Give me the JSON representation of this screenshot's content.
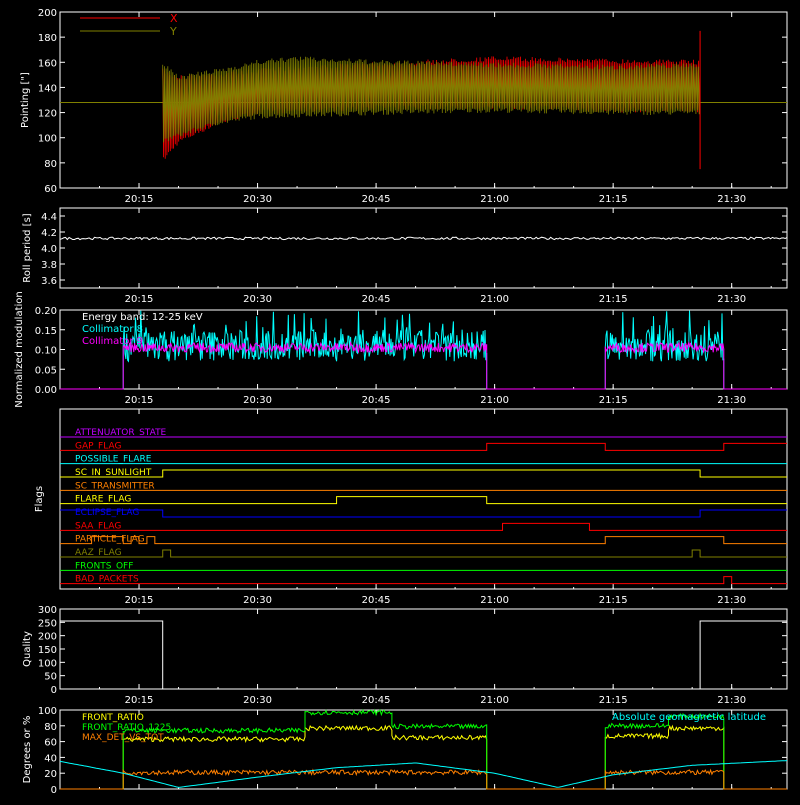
{
  "colors": {
    "background": "#000000",
    "axes": "#ffffff",
    "x_series": "#ff0000",
    "y_series": "#808000",
    "cyan": "#00ffff",
    "magenta": "#ff00ff",
    "green": "#00ff00",
    "yellow": "#ffff00",
    "orange": "#ff8000",
    "blue": "#0000ff",
    "purple": "#c000ff"
  },
  "time_ticks": [
    "20:15",
    "20:30",
    "20:45",
    "21:00",
    "21:15",
    "21:30"
  ],
  "chart_data": [
    {
      "id": "pointing",
      "type": "line",
      "ylabel": "Pointing [\"]",
      "ylim": [
        60,
        200
      ],
      "yticks": [
        "60",
        "80",
        "100",
        "120",
        "140",
        "160",
        "180",
        "200"
      ],
      "time_range": [
        "20:05",
        "21:37"
      ],
      "legend_placement": "top-left",
      "series": [
        {
          "name": "X",
          "color": "#ff0000",
          "t_start": "20:18",
          "t_end": "21:26",
          "x": [
            "20:18",
            "20:20",
            "20:25",
            "20:30",
            "20:35",
            "20:45",
            "21:00",
            "21:15",
            "21:26"
          ],
          "upper": [
            155,
            150,
            152,
            155,
            158,
            160,
            165,
            163,
            162
          ],
          "lower": [
            80,
            95,
            110,
            118,
            120,
            122,
            123,
            120,
            120
          ]
        },
        {
          "name": "Y",
          "color": "#808000",
          "t_start": "20:18",
          "t_end": "21:26",
          "x": [
            "20:18",
            "20:20",
            "20:25",
            "20:30",
            "20:35",
            "20:45",
            "21:00",
            "21:15",
            "21:26"
          ],
          "upper": [
            160,
            150,
            155,
            162,
            165,
            162,
            160,
            158,
            160
          ],
          "lower": [
            95,
            100,
            110,
            115,
            116,
            118,
            120,
            118,
            118
          ]
        }
      ],
      "baseline": 128
    },
    {
      "id": "roll_period",
      "type": "line",
      "ylabel": "Roll period [s]",
      "ylim": [
        3.5,
        4.5
      ],
      "yticks": [
        "3.6",
        "3.8",
        "4.0",
        "4.2",
        "4.4"
      ],
      "series": [
        {
          "name": "",
          "color": "#ffffff",
          "x": [
            "20:05",
            "21:37"
          ],
          "y": [
            4.12,
            4.12
          ]
        }
      ]
    },
    {
      "id": "modulation",
      "type": "line",
      "ylabel": "Normalized modulation",
      "ylim": [
        0,
        0.2
      ],
      "yticks": [
        "0.00",
        "0.05",
        "0.10",
        "0.15",
        "0.20"
      ],
      "annotation": "Energy band: 12-25 keV",
      "series": [
        {
          "name": "Collimator 8",
          "color": "#00ffff",
          "intervals": [
            [
              "20:13",
              "20:59"
            ],
            [
              "21:14",
              "21:29"
            ]
          ],
          "mean": 0.11,
          "spread": 0.04
        },
        {
          "name": "Collimator 9",
          "color": "#ff00ff",
          "intervals": [
            [
              "20:13",
              "20:59"
            ],
            [
              "21:14",
              "21:29"
            ]
          ],
          "mean": 0.105,
          "spread": 0.012
        }
      ]
    },
    {
      "id": "flags",
      "type": "line",
      "ylabel": "Flags",
      "series": [
        {
          "name": "ATTENUATOR_STATE",
          "color": "#c000ff",
          "steps": [
            [
              "20:05",
              0
            ]
          ]
        },
        {
          "name": "GAP_FLAG",
          "color": "#ff0000",
          "steps": [
            [
              "20:05",
              0
            ],
            [
              "20:59",
              1
            ],
            [
              "21:14",
              0
            ],
            [
              "21:29",
              1
            ]
          ]
        },
        {
          "name": "POSSIBLE_FLARE",
          "color": "#00ffff",
          "steps": [
            [
              "20:05",
              0
            ]
          ]
        },
        {
          "name": "SC_IN_SUNLIGHT",
          "color": "#ffff00",
          "steps": [
            [
              "20:05",
              0
            ],
            [
              "20:18",
              1
            ],
            [
              "21:26",
              0
            ]
          ]
        },
        {
          "name": "SC_TRANSMITTER",
          "color": "#ff8000",
          "steps": [
            [
              "20:05",
              0
            ]
          ]
        },
        {
          "name": "FLARE_FLAG",
          "color": "#ffff00",
          "steps": [
            [
              "20:05",
              0
            ],
            [
              "20:40",
              1
            ],
            [
              "20:59",
              0
            ]
          ]
        },
        {
          "name": "ECLIPSE_FLAG",
          "color": "#0000ff",
          "steps": [
            [
              "20:05",
              1
            ],
            [
              "20:18",
              0
            ],
            [
              "21:26",
              1
            ]
          ]
        },
        {
          "name": "SAA_FLAG",
          "color": "#ff0000",
          "steps": [
            [
              "20:05",
              0
            ],
            [
              "21:01",
              1
            ],
            [
              "21:12",
              0
            ]
          ]
        },
        {
          "name": "PARTICLE_FLAG",
          "color": "#ff8000",
          "steps": [
            [
              "20:05",
              0
            ],
            [
              "20:09",
              1
            ],
            [
              "20:13",
              0
            ],
            [
              "20:14",
              1
            ],
            [
              "20:15",
              0
            ],
            [
              "20:16",
              1
            ],
            [
              "20:17",
              0
            ],
            [
              "21:11",
              0
            ],
            [
              "21:12",
              0
            ],
            [
              "21:14",
              1
            ],
            [
              "21:29",
              0
            ]
          ]
        },
        {
          "name": "AAZ_FLAG",
          "color": "#808000",
          "steps": [
            [
              "20:05",
              0
            ],
            [
              "20:18",
              1
            ],
            [
              "20:19",
              0
            ],
            [
              "21:25",
              1
            ],
            [
              "21:26",
              0
            ]
          ]
        },
        {
          "name": "FRONTS_OFF",
          "color": "#00ff00",
          "steps": [
            [
              "20:05",
              0
            ]
          ]
        },
        {
          "name": "BAD_PACKETS",
          "color": "#ff0000",
          "steps": [
            [
              "20:05",
              0
            ],
            [
              "21:29",
              1
            ],
            [
              "21:30",
              0
            ]
          ]
        }
      ]
    },
    {
      "id": "quality",
      "type": "line",
      "ylabel": "Quality",
      "ylim": [
        0,
        300
      ],
      "yticks": [
        "0",
        "50",
        "100",
        "150",
        "200",
        "250",
        "300"
      ],
      "series": [
        {
          "name": "",
          "color": "#ffffff",
          "x": [
            "20:05",
            "20:18",
            "20:18",
            "21:26",
            "21:26",
            "21:37"
          ],
          "y": [
            255,
            255,
            0,
            0,
            255,
            255
          ]
        }
      ]
    },
    {
      "id": "ratios",
      "type": "line",
      "ylabel": "Degrees or %",
      "ylim": [
        0,
        100
      ],
      "yticks": [
        "0",
        "20",
        "40",
        "60",
        "80",
        "100"
      ],
      "series": [
        {
          "name": "FRONT_RATIO",
          "color": "#ffff00",
          "segments": [
            {
              "x": [
                "20:13",
                "20:36"
              ],
              "y": 63
            },
            {
              "x": [
                "20:36",
                "20:47"
              ],
              "y": 77
            },
            {
              "x": [
                "20:47",
                "20:59"
              ],
              "y": 65
            },
            {
              "x": [
                "21:14",
                "21:22"
              ],
              "y": 67
            },
            {
              "x": [
                "21:22",
                "21:29"
              ],
              "y": 77
            }
          ]
        },
        {
          "name": "FRONT_RATIO_1225",
          "color": "#00ff00",
          "segments": [
            {
              "x": [
                "20:13",
                "20:36"
              ],
              "y": 74
            },
            {
              "x": [
                "20:36",
                "20:47"
              ],
              "y": 97
            },
            {
              "x": [
                "20:47",
                "20:59"
              ],
              "y": 79
            },
            {
              "x": [
                "21:14",
                "21:22"
              ],
              "y": 80
            },
            {
              "x": [
                "21:22",
                "21:29"
              ],
              "y": 92
            }
          ]
        },
        {
          "name": "MAX_DET_VS_TOT",
          "color": "#ff8000",
          "segments": [
            {
              "x": [
                "20:13",
                "20:59"
              ],
              "y": 21
            },
            {
              "x": [
                "21:14",
                "21:29"
              ],
              "y": 21
            }
          ]
        },
        {
          "name": "Absolute geomagnetic latitude",
          "color": "#00ffff",
          "curve": {
            "x": [
              "20:05",
              "20:13",
              "20:20",
              "20:30",
              "20:40",
              "20:50",
              "21:00",
              "21:08",
              "21:15",
              "21:25",
              "21:37"
            ],
            "y": [
              35,
              20,
              2,
              15,
              27,
              33,
              20,
              2,
              18,
              30,
              36
            ]
          }
        }
      ]
    }
  ]
}
